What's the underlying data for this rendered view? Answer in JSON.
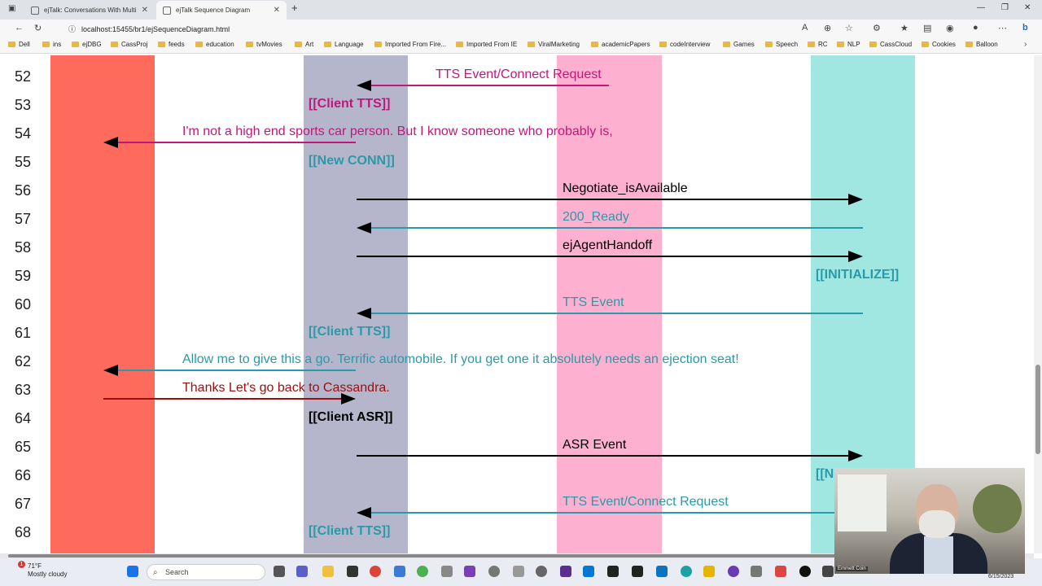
{
  "tabs": [
    {
      "label": "ejTalk: Conversations With Multi",
      "active": false
    },
    {
      "label": "ejTalk Sequence Diagram",
      "active": true
    }
  ],
  "address": {
    "url": "localhost:15455/br1/ejSequenceDiagram.html"
  },
  "bookmarks": [
    "Dell",
    "ins",
    "ejDBG",
    "CassProj",
    "feeds",
    "education",
    "tvMovies",
    "Art",
    "Language",
    "Imported From Fire...",
    "Imported From IE",
    "ViralMarketing",
    "academicPapers",
    "codeInterview",
    "Games",
    "Speech",
    "RC",
    "NLP",
    "CassCloud",
    "Cookies",
    "Balloon"
  ],
  "diagram": {
    "lane_colors": {
      "lane1": "#fe6b5d",
      "lane2": "#b5b5cc",
      "lane3": "#fdb0cf",
      "lane4": "#a0e7e2"
    },
    "rows": [
      "52",
      "53",
      "54",
      "55",
      "56",
      "57",
      "58",
      "59",
      "60",
      "61",
      "62",
      "63",
      "64",
      "65",
      "66",
      "67",
      "68"
    ],
    "messages": [
      {
        "row": "52",
        "text": "TTS Event/Connect Request",
        "color": "#c0187a"
      },
      {
        "row": "54",
        "text": "I'm not a high end sports car person. But I know someone who probably is,",
        "color": "#c0187a"
      },
      {
        "row": "56",
        "text": "Negotiate_isAvailable",
        "color": "#000000"
      },
      {
        "row": "57",
        "text": "200_Ready",
        "color": "#2a9aa8"
      },
      {
        "row": "58",
        "text": "ejAgentHandoff",
        "color": "#000000"
      },
      {
        "row": "60",
        "text": "TTS Event",
        "color": "#2a9aa8"
      },
      {
        "row": "62",
        "text": "Allow me to give this a go. Terrific automobile. If you get one it absolutely needs an ejection seat!",
        "color": "#2a9aa8"
      },
      {
        "row": "63",
        "text": "Thanks Let's go back to Cassandra.",
        "color": "#9a1010"
      },
      {
        "row": "65",
        "text": "ASR Event",
        "color": "#000000"
      },
      {
        "row": "67",
        "text": "TTS Event/Connect Request",
        "color": "#2a9aa8"
      }
    ],
    "tags": [
      {
        "row": "53",
        "text": "[[Client TTS]]",
        "color": "#c0187a"
      },
      {
        "row": "55",
        "text": "[[New CONN]]",
        "color": "#2a9aa8"
      },
      {
        "row": "59",
        "text": "[[INITIALIZE]]",
        "color": "#2a9aa8"
      },
      {
        "row": "61",
        "text": "[[Client TTS]]",
        "color": "#2a9aa8"
      },
      {
        "row": "64",
        "text": "[[Client ASR]]",
        "color": "#000000"
      },
      {
        "row": "66",
        "text": "[[N",
        "color": "#2a9aa8"
      },
      {
        "row": "68",
        "text": "[[Client TTS]]",
        "color": "#2a9aa8"
      }
    ]
  },
  "taskbar": {
    "weather_temp": "71°F",
    "weather_desc": "Mostly cloudy",
    "weather_badge": "1",
    "search_placeholder": "Search",
    "date": "6/15/2023"
  },
  "webcam": {
    "name": "Emmett Coin"
  }
}
